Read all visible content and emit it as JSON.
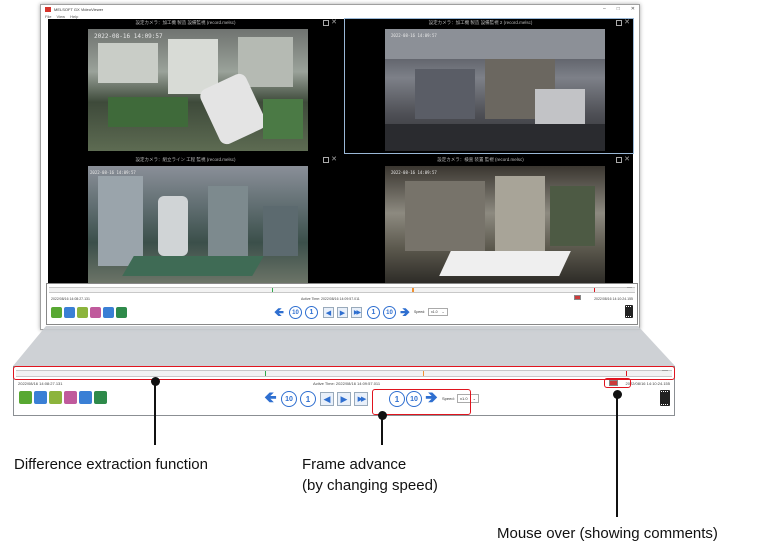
{
  "window": {
    "title": "MELSOFT GX VideoViewer",
    "menu": [
      "File",
      "View",
      "Help"
    ],
    "controls": [
      "–",
      "□",
      "✕"
    ]
  },
  "panes": [
    {
      "title": "設定カメラ：加工機 製造 設備監視 (record.melsc)",
      "timestamp": "2022-08-16 14:09:57"
    },
    {
      "title": "設定カメラ：加工機 製造 設備監視 2 (record.melsc)",
      "timestamp": "2022-08-16 14:09:57"
    },
    {
      "title": "設定カメラ：組立ライン 工程 監視 (record.melsc)",
      "timestamp": "2022-08-16 14:09:57"
    },
    {
      "title": "設定カメラ：検査 装置 監視 (record.melsc)",
      "timestamp": "2022-08-16 14:09:57"
    }
  ],
  "timeline": {
    "start_time": "2022/08/16  14:08:27.131",
    "active_time": "Active Time:  2022/08/16  14:09:57.011",
    "end_time": "2022/08/16  14:10:24.155",
    "markers": [
      {
        "position": 0.38,
        "color": "#2ea84a"
      },
      {
        "position": 0.62,
        "color": "#f09030"
      },
      {
        "position": 0.93,
        "color": "#e0141e"
      }
    ],
    "zoom_toggle": "—"
  },
  "toolbar": {
    "left_tools": [
      {
        "name": "difference-extraction-icon",
        "color": "#58a832"
      },
      {
        "name": "search-video-icon",
        "color": "#3a7fd5"
      },
      {
        "name": "brightness-icon",
        "color": "#8cb43c"
      },
      {
        "name": "color-adjust-icon",
        "color": "#c05a9c"
      },
      {
        "name": "export-icon",
        "color": "#3a7fd5"
      },
      {
        "name": "camera-settings-icon",
        "color": "#2e8a4a"
      }
    ],
    "nav": [
      {
        "name": "jump-start-icon",
        "glyph": "🡸"
      },
      {
        "name": "back-10-icon",
        "glyph": "10"
      },
      {
        "name": "back-1-icon",
        "glyph": "1"
      },
      {
        "name": "reverse-play-icon",
        "glyph": "◀"
      },
      {
        "name": "play-icon",
        "glyph": "▶"
      },
      {
        "name": "fast-forward-icon",
        "glyph": "▶▶"
      },
      {
        "name": "forward-1-icon",
        "glyph": "1"
      },
      {
        "name": "forward-10-icon",
        "glyph": "10"
      },
      {
        "name": "jump-end-icon",
        "glyph": "🡺"
      }
    ],
    "speed_label": "Speed:",
    "speed_value": "x1.0",
    "speed_value_small": "x1.0"
  },
  "callouts": {
    "difference": "Difference extraction function",
    "frame_line1": "Frame advance",
    "frame_line2": "(by changing speed)",
    "mouse_over": "Mouse over (showing comments)"
  },
  "colors": {
    "accent_blue": "#2f6fd0",
    "highlight_red": "#e0141e",
    "marker_green": "#2ea84a",
    "marker_orange": "#f09030"
  }
}
